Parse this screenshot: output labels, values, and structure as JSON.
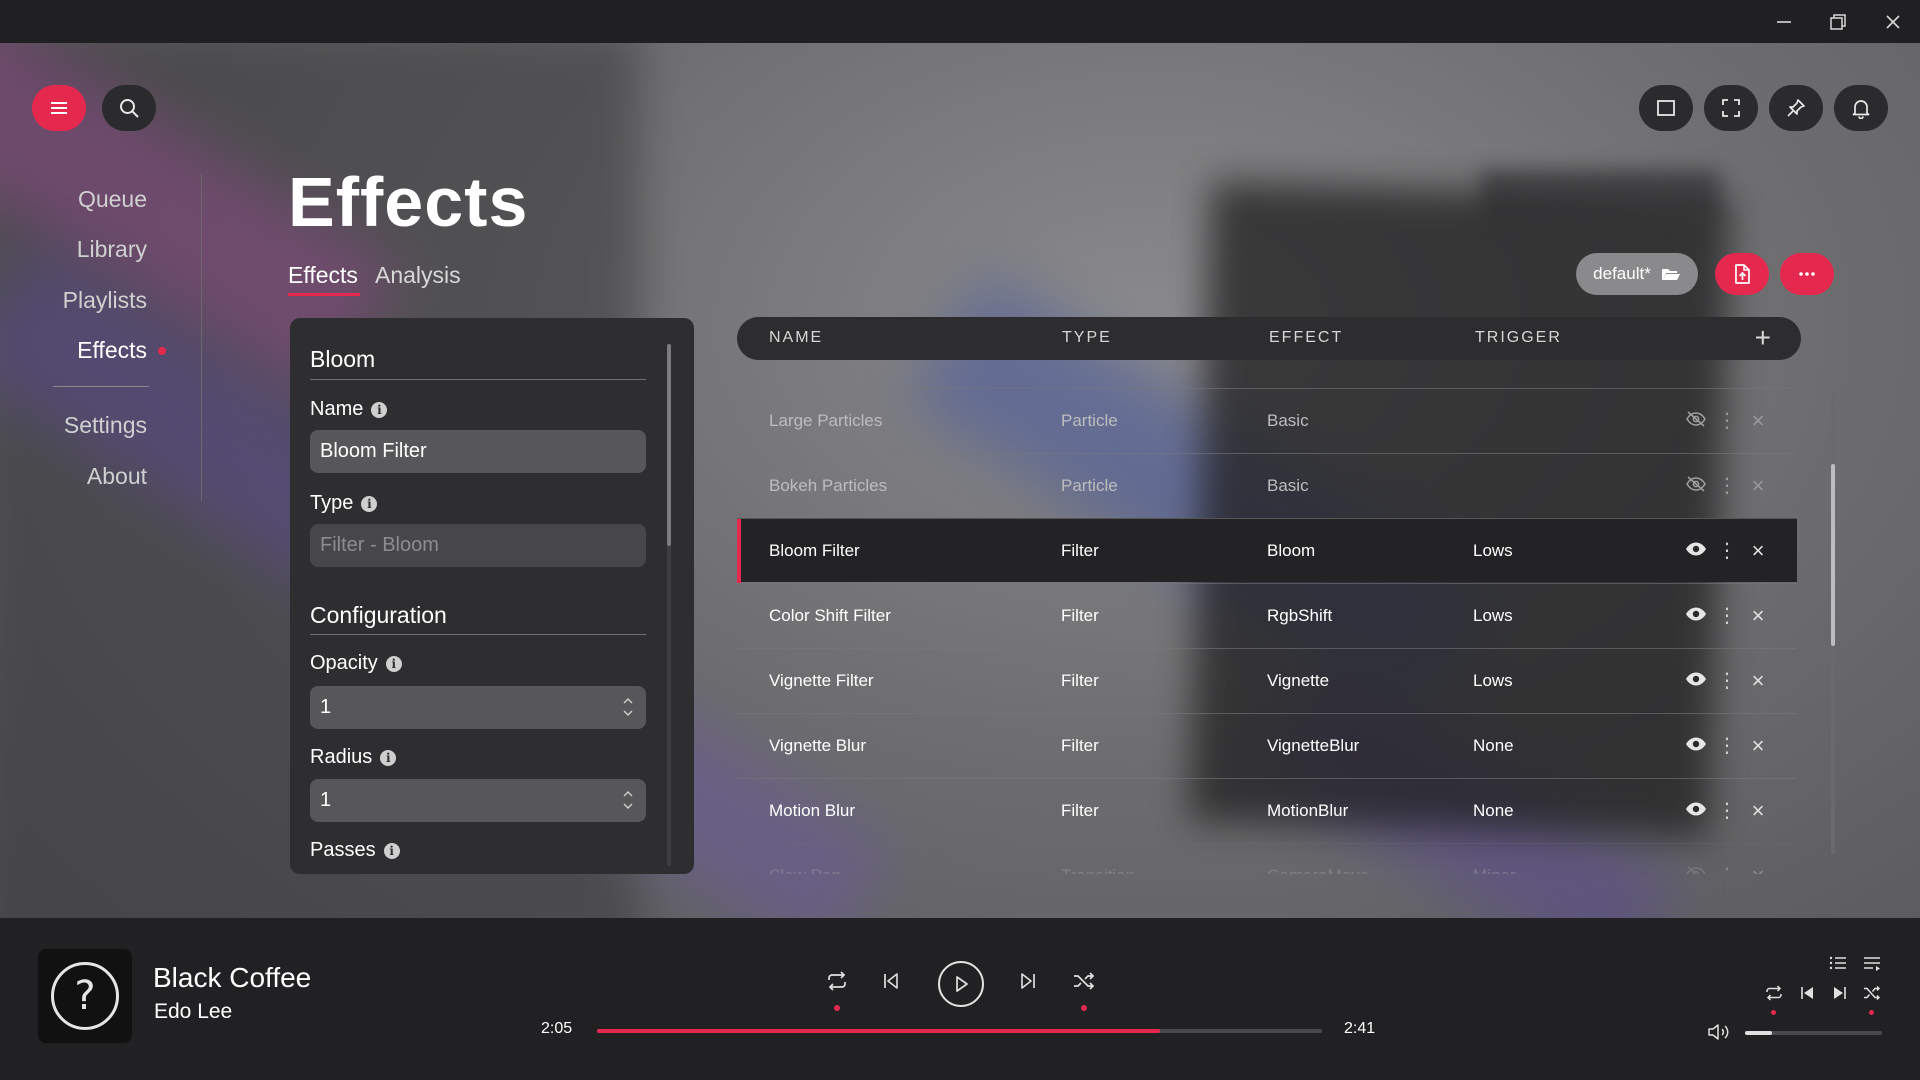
{
  "nav": {
    "items": [
      {
        "label": "Queue",
        "active": false
      },
      {
        "label": "Library",
        "active": false
      },
      {
        "label": "Playlists",
        "active": false
      },
      {
        "label": "Effects",
        "active": true
      }
    ],
    "secondary": [
      {
        "label": "Settings"
      },
      {
        "label": "About"
      }
    ]
  },
  "page": {
    "title": "Effects",
    "tabs": [
      "Effects",
      "Analysis"
    ]
  },
  "config": {
    "section1": "Bloom",
    "name_label": "Name",
    "name_value": "Bloom Filter",
    "type_label": "Type",
    "type_placeholder": "Filter - Bloom",
    "section2": "Configuration",
    "opacity_label": "Opacity",
    "opacity_value": "1",
    "radius_label": "Radius",
    "radius_value": "1",
    "passes_label": "Passes"
  },
  "toolbar": {
    "preset": "default*"
  },
  "table": {
    "headers": [
      "NAME",
      "TYPE",
      "EFFECT",
      "TRIGGER"
    ],
    "rows": [
      {
        "name": "Large Particles",
        "type": "Particle",
        "effect": "Basic",
        "trigger": "",
        "visible": false,
        "state": "faded"
      },
      {
        "name": "Bokeh Particles",
        "type": "Particle",
        "effect": "Basic",
        "trigger": "",
        "visible": false,
        "state": "faded"
      },
      {
        "name": "Bloom Filter",
        "type": "Filter",
        "effect": "Bloom",
        "trigger": "Lows",
        "visible": true,
        "state": "selected"
      },
      {
        "name": "Color Shift Filter",
        "type": "Filter",
        "effect": "RgbShift",
        "trigger": "Lows",
        "visible": true,
        "state": "normal"
      },
      {
        "name": "Vignette Filter",
        "type": "Filter",
        "effect": "Vignette",
        "trigger": "Lows",
        "visible": true,
        "state": "normal"
      },
      {
        "name": "Vignette Blur",
        "type": "Filter",
        "effect": "VignetteBlur",
        "trigger": "None",
        "visible": true,
        "state": "normal"
      },
      {
        "name": "Motion Blur",
        "type": "Filter",
        "effect": "MotionBlur",
        "trigger": "None",
        "visible": true,
        "state": "normal"
      },
      {
        "name": "Slow Pan",
        "type": "Transition",
        "effect": "CameraMove",
        "trigger": "Minor",
        "visible": false,
        "state": "dim"
      }
    ]
  },
  "player": {
    "title": "Black Coffee",
    "artist": "Edo Lee",
    "elapsed": "2:05",
    "total": "2:41",
    "progress": 0.776,
    "volume": 0.2
  },
  "colors": {
    "accent": "#e5294e"
  }
}
